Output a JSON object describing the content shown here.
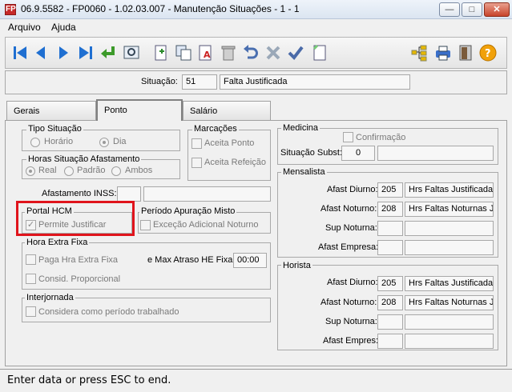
{
  "window": {
    "title": "06.9.5582 - FP0060 - 1.02.03.007 - Manutenção Situações - 1 - 1",
    "app_icon": "FP",
    "controls": {
      "minimize": "—",
      "maximize": "□",
      "close": "✕"
    }
  },
  "menu": {
    "items": [
      "Arquivo",
      "Ajuda"
    ]
  },
  "toolbar": {
    "icons": [
      "first-icon",
      "prev-icon",
      "next-icon",
      "last-icon",
      "enter-icon",
      "preview-icon",
      "new-icon",
      "copy-icon",
      "text-format-icon",
      "trash-icon",
      "undo-icon",
      "cancel-icon",
      "confirm-icon",
      "note-icon",
      "tree-icon",
      "printer-icon",
      "exit-door-icon",
      "help-icon"
    ]
  },
  "situacao": {
    "label": "Situação:",
    "code": "51",
    "description": "Falta Justificada"
  },
  "tabs": [
    "Gerais",
    "Ponto",
    "Salário"
  ],
  "active_tab": "Ponto",
  "tipo_situacao": {
    "title": "Tipo Situação",
    "options": [
      "Horário",
      "Dia"
    ],
    "selected": "Dia"
  },
  "horas_afastamento": {
    "title": "Horas Situação Afastamento",
    "options": [
      "Real",
      "Padrão",
      "Ambos"
    ],
    "selected": "Real"
  },
  "marcacoes": {
    "title": "Marcações",
    "options": [
      "Aceita Ponto",
      "Aceita Refeição"
    ]
  },
  "afastamento_inss": {
    "label": "Afastamento INSS:"
  },
  "portal_hcm": {
    "title": "Portal HCM",
    "option": "Permite Justificar",
    "checked": true
  },
  "periodo_apuracao": {
    "title": "Período Apuração Misto",
    "option": "Exceção Adicional Noturno"
  },
  "hora_extra": {
    "title": "Hora Extra Fixa",
    "paga": "Paga Hra Extra Fixa",
    "consid": "Consid. Proporcional",
    "max_atraso_label": "e Max Atraso HE Fixa:",
    "max_atraso_value": "00:00"
  },
  "interjornada": {
    "title": "Interjornada",
    "option": "Considera como período trabalhado"
  },
  "medicina": {
    "title": "Medicina",
    "confirmacao": "Confirmação",
    "subst_label": "Situação Subst:",
    "subst_value": "0"
  },
  "mensalista": {
    "title": "Mensalista",
    "rows": [
      {
        "label": "Afast Diurno:",
        "code": "205",
        "desc": "Hrs Faltas Justificadas"
      },
      {
        "label": "Afast Noturno:",
        "code": "208",
        "desc": "Hrs Faltas Noturnas Ju"
      },
      {
        "label": "Sup Noturna:",
        "code": "",
        "desc": ""
      },
      {
        "label": "Afast Empresa:",
        "code": "",
        "desc": ""
      }
    ]
  },
  "horista": {
    "title": "Horista",
    "rows": [
      {
        "label": "Afast Diurno:",
        "code": "205",
        "desc": "Hrs Faltas Justificadas"
      },
      {
        "label": "Afast Noturno:",
        "code": "208",
        "desc": "Hrs Faltas Noturnas Ju"
      },
      {
        "label": "Sup Noturna:",
        "code": "",
        "desc": ""
      },
      {
        "label": "Afast Empres:",
        "code": "",
        "desc": ""
      }
    ]
  },
  "status": {
    "text": "Enter data or press ESC to end."
  }
}
